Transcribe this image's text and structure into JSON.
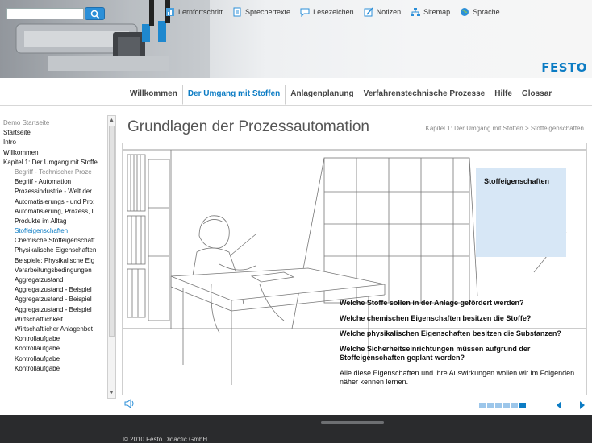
{
  "header": {
    "search": {
      "placeholder": ""
    },
    "toolbar": [
      {
        "label": "Lernfortschritt",
        "icon": "progress-icon"
      },
      {
        "label": "Sprechertexte",
        "icon": "document-icon"
      },
      {
        "label": "Lesezeichen",
        "icon": "speech-bubble-icon"
      },
      {
        "label": "Notizen",
        "icon": "pencil-icon"
      },
      {
        "label": "Sitemap",
        "icon": "sitemap-icon"
      },
      {
        "label": "Sprache",
        "icon": "globe-icon"
      }
    ],
    "logo": "FESTO"
  },
  "nav": {
    "tabs": [
      {
        "label": "Willkommen",
        "active": false
      },
      {
        "label": "Der Umgang mit Stoffen",
        "active": true
      },
      {
        "label": "Anlagenplanung",
        "active": false
      },
      {
        "label": "Verfahrenstechnische Prozesse",
        "active": false
      },
      {
        "label": "Hilfe",
        "active": false
      },
      {
        "label": "Glossar",
        "active": false
      }
    ]
  },
  "sidebar": {
    "items": [
      {
        "label": "Demo Startseite",
        "level": 0,
        "state": "muted"
      },
      {
        "label": "Startseite",
        "level": 0,
        "state": "normal"
      },
      {
        "label": "Intro",
        "level": 0,
        "state": "normal"
      },
      {
        "label": "Willkommen",
        "level": 0,
        "state": "normal"
      },
      {
        "label": "Kapitel 1: Der Umgang mit Stoffe",
        "level": 0,
        "state": "normal"
      },
      {
        "label": "Begriff - Technischer Proze",
        "level": 1,
        "state": "muted"
      },
      {
        "label": "Begriff - Automation",
        "level": 1,
        "state": "normal"
      },
      {
        "label": "Prozessindustrie - Welt der",
        "level": 1,
        "state": "normal"
      },
      {
        "label": "Automatisierungs - und Pro:",
        "level": 1,
        "state": "normal"
      },
      {
        "label": "Automatisierung, Prozess, L",
        "level": 1,
        "state": "normal"
      },
      {
        "label": "Produkte im Alltag",
        "level": 1,
        "state": "normal"
      },
      {
        "label": "Stoffeigenschaften",
        "level": 1,
        "state": "selected"
      },
      {
        "label": "Chemische Stoffeigenschaft",
        "level": 1,
        "state": "normal"
      },
      {
        "label": "Physikalische Eigenschaften",
        "level": 1,
        "state": "normal"
      },
      {
        "label": "Beispiele: Physikalische Eig",
        "level": 1,
        "state": "normal"
      },
      {
        "label": "Verarbeitungsbedingungen",
        "level": 1,
        "state": "normal"
      },
      {
        "label": "Aggregatzustand",
        "level": 1,
        "state": "normal"
      },
      {
        "label": "Aggregatzustand - Beispiel",
        "level": 1,
        "state": "normal"
      },
      {
        "label": "Aggregatzustand - Beispiel",
        "level": 1,
        "state": "normal"
      },
      {
        "label": "Aggregatzustand - Beispiel",
        "level": 1,
        "state": "normal"
      },
      {
        "label": "Wirtschaftlichkeit",
        "level": 1,
        "state": "normal"
      },
      {
        "label": "Wirtschaftlicher Anlagenbet",
        "level": 1,
        "state": "normal"
      },
      {
        "label": "Kontrollaufgabe",
        "level": 1,
        "state": "normal"
      },
      {
        "label": "Kontrollaufgabe",
        "level": 1,
        "state": "normal"
      },
      {
        "label": "Kontrollaufgabe",
        "level": 1,
        "state": "normal"
      },
      {
        "label": "Kontrollaufgabe",
        "level": 1,
        "state": "normal"
      }
    ]
  },
  "main": {
    "title": "Grundlagen der Prozessautomation",
    "breadcrumb": "Kapitel 1: Der Umgang mit Stoffen  >  Stoffeigenschaften",
    "info_box_title": "Stoffeigenschaften",
    "questions": [
      "Welche Stoffe sollen in der Anlage gefördert werden?",
      "Welche chemischen Eigenschaften besitzen die Stoffe?",
      "Welche physikalischen Eigenschaften besitzen die Substanzen?",
      "Welche Sicherheitseinrichtungen müssen aufgrund der Stoffeigenschaften geplant werden?"
    ],
    "closing_text": "Alle diese Eigenschaften und ihre Auswirkungen wollen wir im Folgenden näher kennen lernen.",
    "pager": {
      "total": 6,
      "current": 6
    }
  },
  "footer": {
    "copyright": "© 2010 Festo Didactic GmbH"
  },
  "colors": {
    "accent": "#0c7cc4",
    "info_box": "#d7e7f6",
    "pager_inactive": "#9cc6ea",
    "page_bg": "#2a2b2d"
  }
}
